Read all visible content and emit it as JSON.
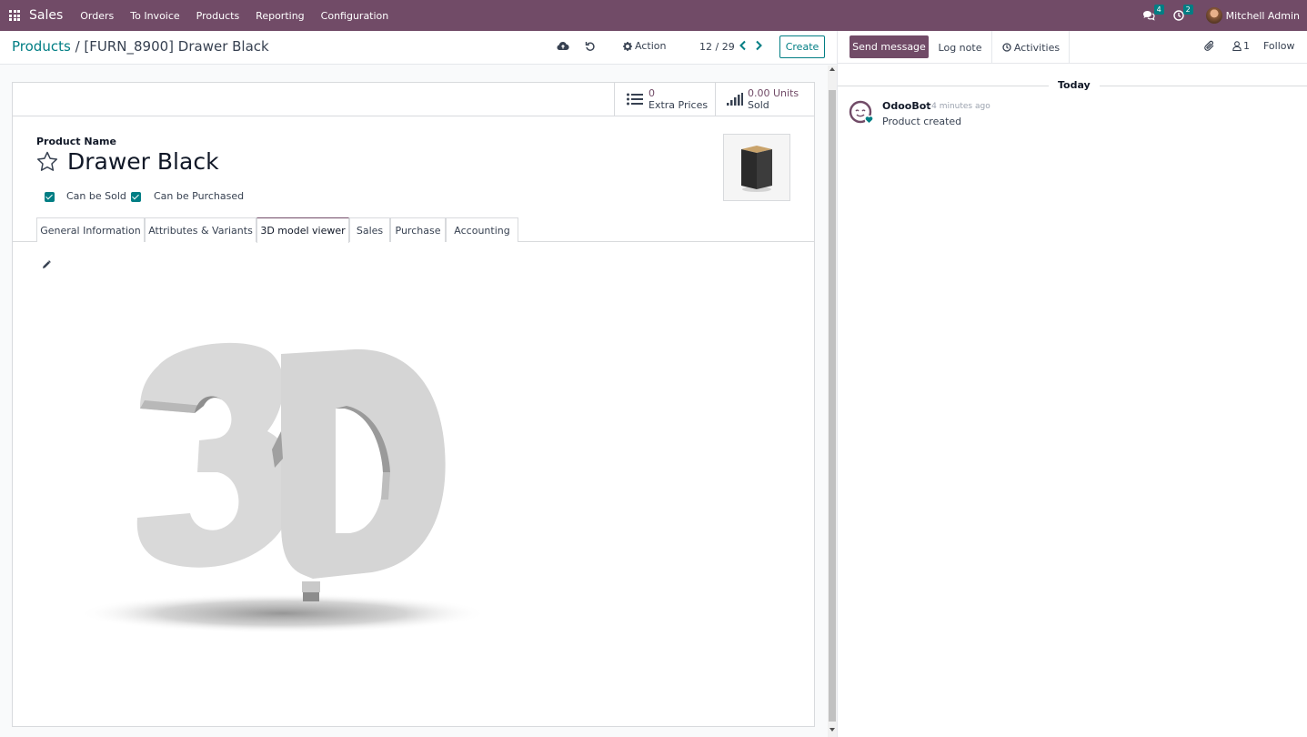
{
  "navbar": {
    "app_name": "Sales",
    "menu": [
      "Orders",
      "To Invoice",
      "Products",
      "Reporting",
      "Configuration"
    ],
    "messages_badge": "4",
    "activities_badge": "2",
    "user_name": "Mitchell Admin"
  },
  "control": {
    "breadcrumb_parent": "Products",
    "breadcrumb_separator": "/",
    "breadcrumb_current": "[FURN_8900] Drawer Black",
    "action_label": "Action",
    "pager": "12 / 29",
    "create_label": "Create"
  },
  "stats": {
    "extra_prices_value": "0",
    "extra_prices_label": "Extra Prices",
    "sold_value": "0.00 Units",
    "sold_label": "Sold"
  },
  "form": {
    "field_label": "Product Name",
    "product_name": "Drawer Black",
    "can_be_sold_label": "Can be Sold",
    "can_be_purchased_label": "Can be Purchased",
    "tabs": [
      "General Information",
      "Attributes & Variants",
      "3D model viewer",
      "Sales",
      "Purchase",
      "Accounting"
    ],
    "active_tab": "3D model viewer"
  },
  "chatter": {
    "send_message_label": "Send message",
    "log_note_label": "Log note",
    "activities_label": "Activities",
    "followers_count": "1",
    "follow_label": "Follow",
    "date_separator": "Today",
    "message": {
      "author": "OdooBot",
      "date": "- 4 minutes ago",
      "body": "Product created"
    }
  },
  "colors": {
    "brand": "#714b67",
    "accent": "#017e84"
  },
  "icons": [
    "apps-icon",
    "chat-icon",
    "clock-icon",
    "cloud-upload-icon",
    "undo-icon",
    "gear-icon",
    "chevron-left-icon",
    "chevron-right-icon",
    "list-icon",
    "signal-icon",
    "star-icon",
    "pencil-icon",
    "paperclip-icon",
    "user-icon"
  ]
}
